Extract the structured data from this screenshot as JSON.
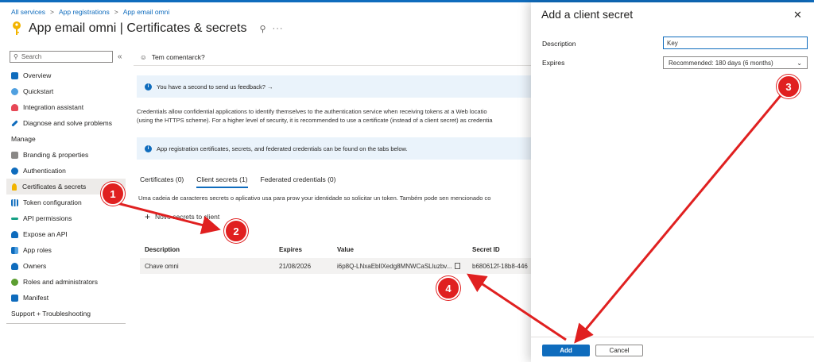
{
  "breadcrumb": {
    "items": [
      "All services",
      "App registrations",
      "App email omni"
    ],
    "separator": ">"
  },
  "page_title": "App email omni | Certificates & secrets",
  "sidebar": {
    "search_placeholder": "Search",
    "items": [
      {
        "label": "Overview",
        "icon": "grid-icon",
        "color": "#0f6cbd"
      },
      {
        "label": "Quickstart",
        "icon": "cloud-icon",
        "color": "#0f6cbd"
      },
      {
        "label": "Integration assistant",
        "icon": "rocket-icon",
        "color": "#e74856"
      },
      {
        "label": "Diagnose and solve problems",
        "icon": "wrench-icon",
        "color": "#0f6cbd"
      }
    ],
    "manage_heading": "Manage",
    "manage_items": [
      {
        "label": "Branding & properties",
        "icon": "branding-icon",
        "color": "#6b6b6b"
      },
      {
        "label": "Authentication",
        "icon": "auth-icon",
        "color": "#0f6cbd"
      },
      {
        "label": "Certificates & secrets",
        "icon": "key-icon",
        "color": "#f2b400"
      },
      {
        "label": "Token configuration",
        "icon": "token-icon",
        "color": "#0f6cbd"
      },
      {
        "label": "API permissions",
        "icon": "permissions-icon",
        "color": "#16a085"
      },
      {
        "label": "Expose an API",
        "icon": "cloud-api-icon",
        "color": "#0f6cbd"
      },
      {
        "label": "App roles",
        "icon": "app-roles-icon",
        "color": "#0f6cbd"
      },
      {
        "label": "Owners",
        "icon": "owners-icon",
        "color": "#0f6cbd"
      },
      {
        "label": "Roles and administrators",
        "icon": "roles-icon",
        "color": "#5c9e31"
      },
      {
        "label": "Manifest",
        "icon": "manifest-icon",
        "color": "#0f6cbd"
      }
    ],
    "support_heading": "Support + Troubleshooting"
  },
  "main": {
    "feedback_link": "Tem comentarck?",
    "feedback_banner": "You have a second to send us feedback? →",
    "description_line1": "Credentials allow confidential applications to identify themselves to the authentication service when receiving tokens at a Web locatio",
    "description_line2": "(using the HTTPS scheme). For a higher level of security, it is recommended to use a certificate (instead of a client secret) as credentia",
    "info_banner": "App registration certificates, secrets, and federated credentials can be found on the tabs below.",
    "tabs": [
      "Certificates (0)",
      "Client secrets (1)",
      "Federated credentials (0)"
    ],
    "tab_description": "Uma cadeia de caracteres secrets o aplicativo usa para prow your identidade so solicitar un token. Também pode sen mencionado co",
    "new_secret_label": "Novo secrets to client",
    "table": {
      "headers": [
        "Description",
        "Expires",
        "Value",
        "Secret ID"
      ],
      "rows": [
        [
          "Chave omni",
          "21/08/2026",
          "i6p8Q-LNxaEbIlXedg8MNWCaSLluzbv...",
          "b680612f-18b8-446"
        ]
      ]
    }
  },
  "panel": {
    "title": "Add a client secret",
    "description_label": "Description",
    "description_value": "Key",
    "expires_label": "Expires",
    "expires_value": "Recommended: 180 days (6 months)",
    "add_label": "Add",
    "cancel_label": "Cancel"
  },
  "annotations": [
    "1",
    "2",
    "3",
    "4"
  ],
  "colors": {
    "accent": "#0f6cbd",
    "annotation": "#e02020",
    "info_bg": "#eaf3fb"
  }
}
